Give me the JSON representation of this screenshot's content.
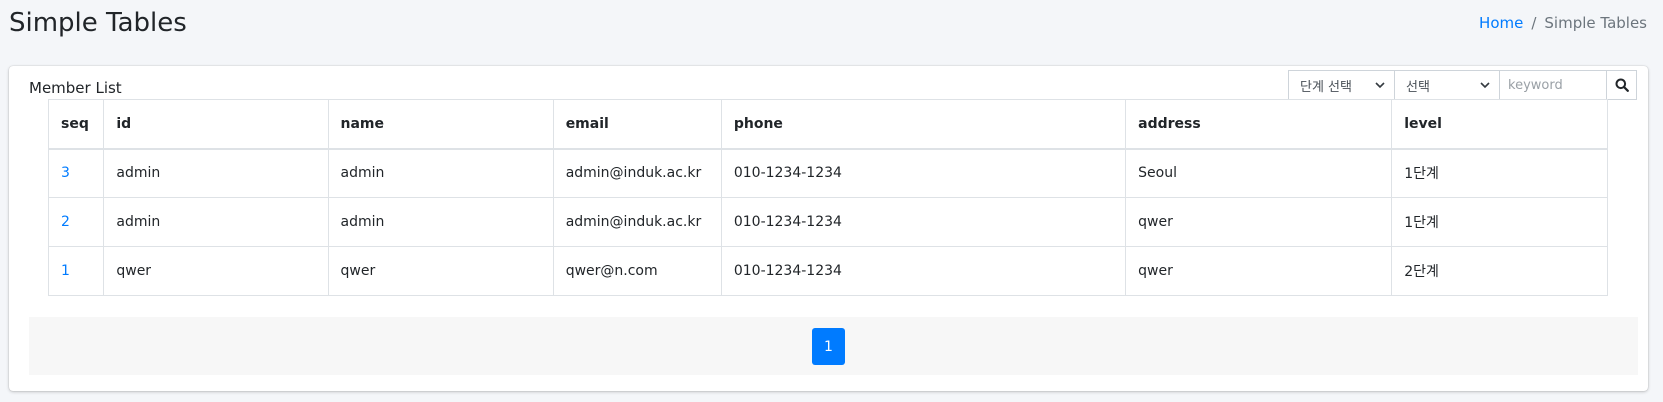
{
  "header": {
    "title": "Simple Tables",
    "breadcrumb": {
      "home": "Home",
      "separator": "/",
      "current": "Simple Tables"
    }
  },
  "card": {
    "title": "Member List",
    "search": {
      "level_select": "단계 선택",
      "field_select": "선택",
      "keyword_placeholder": "keyword",
      "button_icon": "search-icon"
    },
    "table": {
      "columns": [
        "seq",
        "id",
        "name",
        "email",
        "phone",
        "address",
        "level"
      ],
      "rows": [
        {
          "seq": "3",
          "id": "admin",
          "name": "admin",
          "email": "admin@induk.ac.kr",
          "phone": "010-1234-1234",
          "address": "Seoul",
          "level": "1단계"
        },
        {
          "seq": "2",
          "id": "admin",
          "name": "admin",
          "email": "admin@induk.ac.kr",
          "phone": "010-1234-1234",
          "address": "qwer",
          "level": "1단계"
        },
        {
          "seq": "1",
          "id": "qwer",
          "name": "qwer",
          "email": "qwer@n.com",
          "phone": "010-1234-1234",
          "address": "qwer",
          "level": "2단계"
        }
      ]
    },
    "pagination": {
      "pages": [
        "1"
      ],
      "current": "1"
    }
  },
  "colors": {
    "link": "#007bff",
    "active_page": "#007bff",
    "background": "#f4f6f9"
  }
}
